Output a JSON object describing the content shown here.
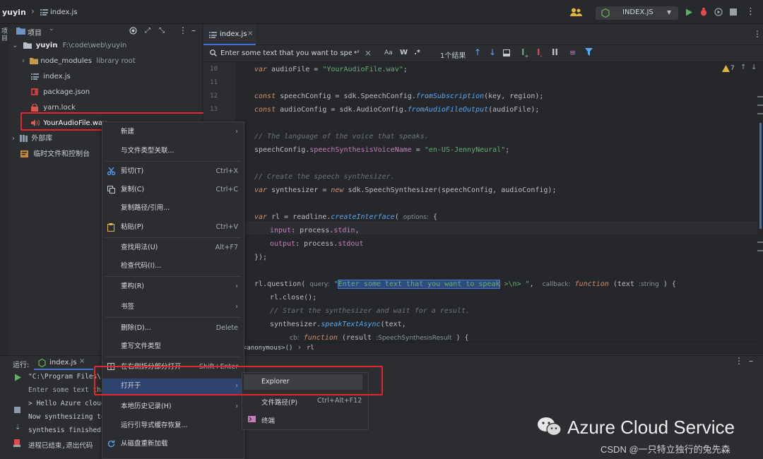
{
  "topbar": {
    "project": "yuyin",
    "file": "index.js",
    "run_config": "INDEX.JS"
  },
  "project_panel": {
    "title": "项目",
    "tree": [
      {
        "label": "yuyin",
        "path": "F:\\code\\web\\yuyin"
      },
      {
        "label": "node_modules",
        "note": "library root"
      },
      {
        "label": "index.js"
      },
      {
        "label": "package.json"
      },
      {
        "label": "yarn.lock"
      },
      {
        "label": "YourAudioFile.wav"
      },
      {
        "label": "外部库"
      },
      {
        "label": "临时文件和控制台"
      }
    ]
  },
  "editor": {
    "tab": "index.js",
    "search": {
      "placeholder": "Enter some text that you want to speak",
      "case": "Aa",
      "word": "W",
      "regex": ".*",
      "count": "1个结果"
    },
    "warnings": "7",
    "lines": [
      "10",
      "11",
      "12",
      "13"
    ],
    "code": {
      "l10a": "var",
      "l10b": " audioFile = ",
      "l10c": "\"YourAudioFile.wav\"",
      "l10d": ";",
      "l12a": "const",
      "l12b": " speechConfig = sdk.SpeechConfig.",
      "l12c": "fromSubscription",
      "l12d": "(key, region);",
      "l13a": "const",
      "l13b": " audioConfig = sdk.AudioConfig.",
      "l13c": "fromAudioFileOutput",
      "l13d": "(audioFile);",
      "c1": "// The language of the voice that speaks.",
      "l16a": "speechConfig.",
      "l16b": "speechSynthesisVoiceName",
      "l16c": " = ",
      "l16d": "\"en-US-JennyNeural\"",
      "l16e": ";",
      "c2": "// Create the speech synthesizer.",
      "l19a": "var",
      "l19b": " synthesizer = ",
      "l19c": "new",
      "l19d": " sdk.SpeechSynthesizer(speechConfig, audioConfig);",
      "l21a": "var",
      "l21b": " rl = readline.",
      "l21c": "createInterface",
      "l21d": "(",
      "l21e": "options:",
      "l21f": " {",
      "l22a": "input",
      "l22b": ": process.",
      "l22c": "stdin",
      "l22d": ",",
      "l23a": "output",
      "l23b": ": process.",
      "l23c": "stdout",
      "l24": "});",
      "l26a": "rl.question(",
      "l26b": "query:",
      "l26c": "\"",
      "l26d": "Enter some text that you want to speak",
      "l26e": " >\\n> \"",
      "l26f": ",",
      "l26g": "callback:",
      "l26h": "function",
      "l26i": " (text ",
      "l26j": ":string",
      "l26k": " ) {",
      "l27": "rl.close();",
      "c3": "// Start the synthesizer and wait for a result.",
      "l29a": "synthesizer.",
      "l29b": "speakTextAsync",
      "l29c": "(text,",
      "l30a": "cb:",
      "l30b": "function",
      "l30c": " (result ",
      "l30d": ":SpeechSynthesisResult",
      "l30e": " ) {"
    },
    "breadcrumb": [
      "<anonymous>()",
      "rl"
    ]
  },
  "context_menu": {
    "items": [
      {
        "label": "新建"
      },
      {
        "label": "与文件类型关联..."
      },
      {
        "label": "剪切(T)",
        "shortcut": "Ctrl+X"
      },
      {
        "label": "复制(C)",
        "shortcut": "Ctrl+C"
      },
      {
        "label": "复制路径/引用..."
      },
      {
        "label": "粘贴(P)",
        "shortcut": "Ctrl+V"
      },
      {
        "label": "查找用法(U)",
        "shortcut": "Alt+F7"
      },
      {
        "label": "检查代码(I)..."
      },
      {
        "label": "重构(R)"
      },
      {
        "label": "书签"
      },
      {
        "label": "删除(D)...",
        "shortcut": "Delete"
      },
      {
        "label": "重写文件类型"
      },
      {
        "label": "在右侧拆分部分打开",
        "shortcut": "Shift+Enter"
      },
      {
        "label": "打开于"
      },
      {
        "label": "本地历史记录(H)"
      },
      {
        "label": "运行引导式缓存恢复..."
      },
      {
        "label": "从磁盘重新加载"
      }
    ],
    "submenu": [
      {
        "label": "Explorer"
      },
      {
        "label": "文件路径(P)",
        "shortcut": "Ctrl+Alt+F12"
      },
      {
        "label": "终端"
      }
    ]
  },
  "run_panel": {
    "label": "运行:",
    "tab": "index.js",
    "lines": [
      "\"C:\\Program Files\\",
      "Enter some text tha",
      "> Hello Azure cloud",
      "Now synthesizing to",
      "synthesis finished",
      "进程已结束,退出代码"
    ]
  },
  "watermark": {
    "brand": "Azure Cloud Service",
    "credit": "CSDN @一只特立独行的兔先森"
  }
}
